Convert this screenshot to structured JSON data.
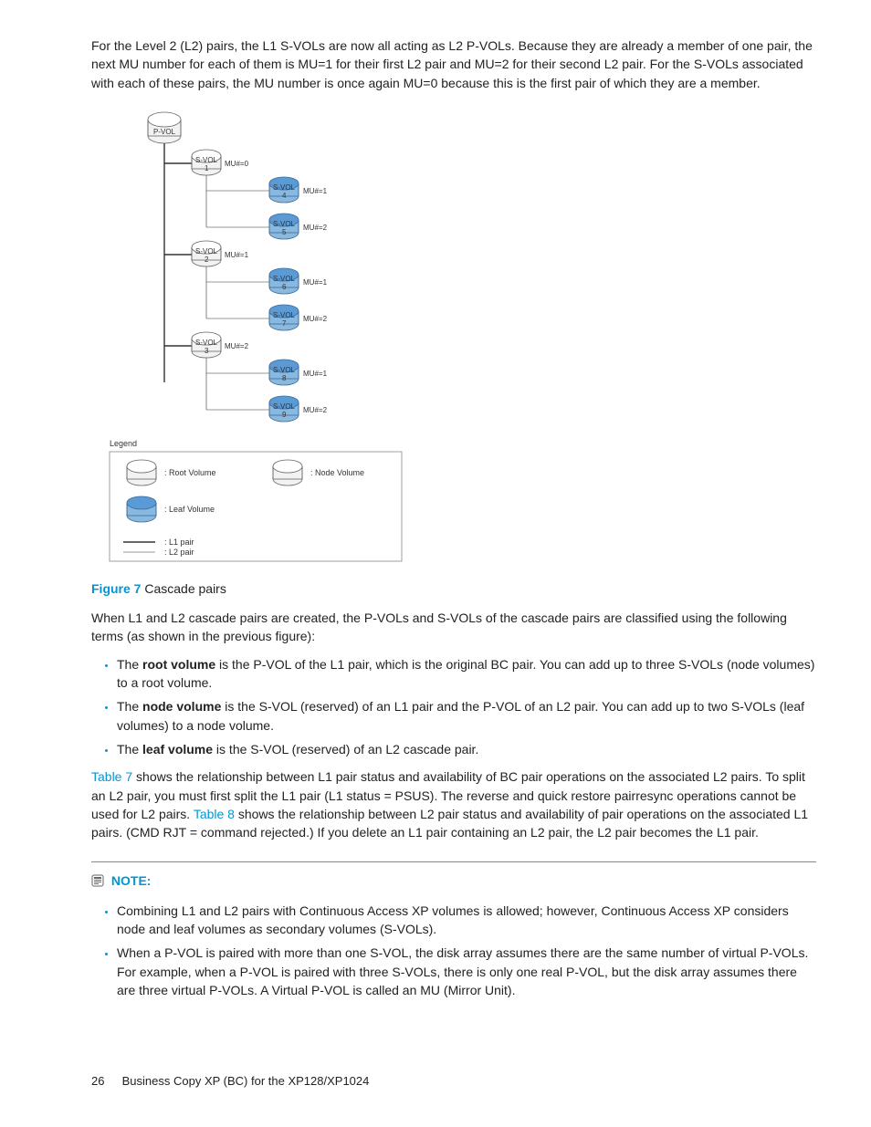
{
  "para_intro": "For the Level 2 (L2) pairs, the L1 S-VOLs are now all acting as L2 P-VOLs. Because they are already a member of one pair, the next MU number for each of them is MU=1 for their first L2 pair and MU=2 for their second L2 pair. For the S-VOLs associated with each of these pairs, the MU number is once again MU=0 because this is the first pair of which they are a member.",
  "diagram": {
    "pvol": "P-VOL",
    "nodes": [
      {
        "line1": "S-VOL",
        "line2": "1",
        "mu": "MU#=0"
      },
      {
        "line1": "S-VOL",
        "line2": "2",
        "mu": "MU#=1"
      },
      {
        "line1": "S-VOL",
        "line2": "3",
        "mu": "MU#=2"
      }
    ],
    "leaves": [
      {
        "line1": "S-VOL",
        "line2": "4",
        "mu": "MU#=1"
      },
      {
        "line1": "S-VOL",
        "line2": "5",
        "mu": "MU#=2"
      },
      {
        "line1": "S-VOL",
        "line2": "6",
        "mu": "MU#=1"
      },
      {
        "line1": "S-VOL",
        "line2": "7",
        "mu": "MU#=2"
      },
      {
        "line1": "S-VOL",
        "line2": "8",
        "mu": "MU#=1"
      },
      {
        "line1": "S-VOL",
        "line2": "9",
        "mu": "MU#=2"
      }
    ],
    "legend_title": "Legend",
    "legend_root": ": Root Volume",
    "legend_node": ": Node Volume",
    "legend_leaf": ": Leaf Volume",
    "legend_l1": ": L1 pair",
    "legend_l2": ": L2 pair"
  },
  "figure_label": "Figure 7",
  "figure_caption": "Cascade pairs",
  "para_after_fig": "When L1 and L2 cascade pairs are created, the P-VOLs and S-VOLs of the cascade pairs are classified using the following terms (as shown in the previous figure):",
  "bullets_main": {
    "b0_pre": "The ",
    "b0_bold": "root volume",
    "b0_post": " is the P-VOL of the L1 pair, which is the original BC pair. You can add up to three S-VOLs (node volumes) to a root volume.",
    "b1_pre": "The ",
    "b1_bold": "node volume",
    "b1_post": " is the S-VOL (reserved) of an L1 pair and the P-VOL of an L2 pair. You can add up to two S-VOLs (leaf volumes) to a node volume.",
    "b2_pre": "The ",
    "b2_bold": "leaf volume",
    "b2_post": " is the S-VOL (reserved) of an L2 cascade pair."
  },
  "para_tables": {
    "t7": "Table 7",
    "t7_after": " shows the relationship between L1 pair status and availability of BC pair operations on the associated L2 pairs. To split an L2 pair, you must first split the L1 pair (L1 status = PSUS). The reverse and quick restore pairresync operations cannot be used for L2 pairs. ",
    "t8": "Table 8",
    "t8_after": " shows the relationship between L2 pair status and availability of pair operations on the associated L1 pairs. (CMD RJT = command rejected.) If you delete an L1 pair containing an L2 pair, the L2 pair becomes the L1 pair."
  },
  "note_label": "NOTE:",
  "note_bullets": {
    "n0_a": "Combining L1 and L2 pairs with ",
    "n0_b": "Continuous Access XP",
    "n0_c": " volumes is allowed; however, ",
    "n0_d": "Continuous Access XP",
    "n0_e": " considers node and leaf volumes as secondary volumes (S-VOLs).",
    "n1": "When a P-VOL is paired with more than one S-VOL, the disk array assumes there are the same number of virtual P-VOLs. For example, when a P-VOL is paired with three S-VOLs, there is only one real P-VOL, but the disk array assumes there are three virtual P-VOLs. A Virtual P-VOL is called an MU (Mirror Unit)."
  },
  "footer_page": "26",
  "footer_text": "Business Copy XP (BC) for the XP128/XP1024"
}
